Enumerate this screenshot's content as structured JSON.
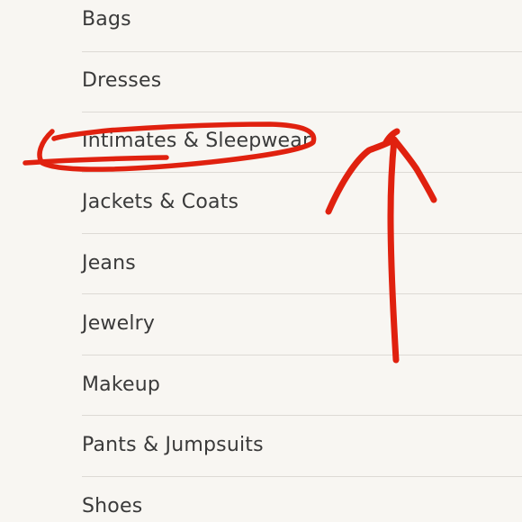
{
  "categories": {
    "items": [
      {
        "label": "Bags"
      },
      {
        "label": "Dresses"
      },
      {
        "label": "Intimates & Sleepwear"
      },
      {
        "label": "Jackets & Coats"
      },
      {
        "label": "Jeans"
      },
      {
        "label": "Jewelry"
      },
      {
        "label": "Makeup"
      },
      {
        "label": "Pants & Jumpsuits"
      },
      {
        "label": "Shoes"
      }
    ]
  },
  "annotation": {
    "color": "#e0210f",
    "circled_item": "Intimates & Sleepwear"
  }
}
